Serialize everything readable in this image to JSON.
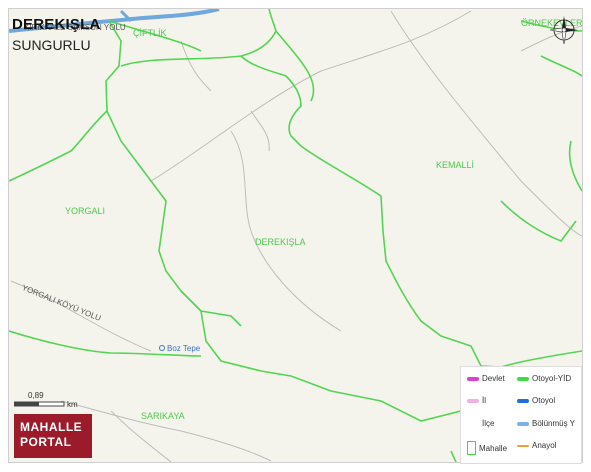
{
  "map": {
    "title": "DEREKIŞLA",
    "subtitle": "SUNGURLU",
    "places": [
      {
        "id": "ciftlik",
        "name": "ÇİFTLİK"
      },
      {
        "id": "ornekevler",
        "name": "ÖRNEKEVLER"
      },
      {
        "id": "kemalli",
        "name": "KEMALLİ"
      },
      {
        "id": "yorgali",
        "name": "YORGALI"
      },
      {
        "id": "derekisla",
        "name": "DEREKIŞLA"
      },
      {
        "id": "sarikaya",
        "name": "SARIKAYA"
      }
    ],
    "road_labels": {
      "kirikkale": "KIRIKKALE SAMSUN YOLU",
      "yorgali_koyu": "YORGALI KÖYÜ YOLU"
    },
    "poi": "Boz Tepe",
    "scale": {
      "value": "0,89",
      "unit": "km"
    },
    "logo": {
      "line1": "MAHALLE",
      "line2": "PORTAL"
    },
    "compass": "compass-rose",
    "colors": {
      "background": "#f5f4ec",
      "boundary": "#52d652",
      "highway": "#6fa8dc",
      "minor_road": "#b8b8b8",
      "logo": "#9b1b2a"
    }
  },
  "legend": {
    "items": [
      {
        "id": "devlet",
        "label": "Devlet",
        "color": "#e040c8"
      },
      {
        "id": "otoyol-yid",
        "label": "Otoyol-YİD",
        "color": "#3ddc3d"
      },
      {
        "id": "il",
        "label": "İl",
        "color": "#f0b0e0"
      },
      {
        "id": "otoyol",
        "label": "Otoyol",
        "color": "#1f6fe0"
      },
      {
        "id": "ilce",
        "label": "İlçe",
        "color": "#ffffff"
      },
      {
        "id": "bolunmus",
        "label": "Bölünmüş Y",
        "color": "#7ab3ea"
      },
      {
        "id": "mahalle",
        "label": "Mahalle",
        "color": "#3ddc3d"
      },
      {
        "id": "anayol",
        "label": "Anayol",
        "color": "#f0a030"
      }
    ]
  }
}
